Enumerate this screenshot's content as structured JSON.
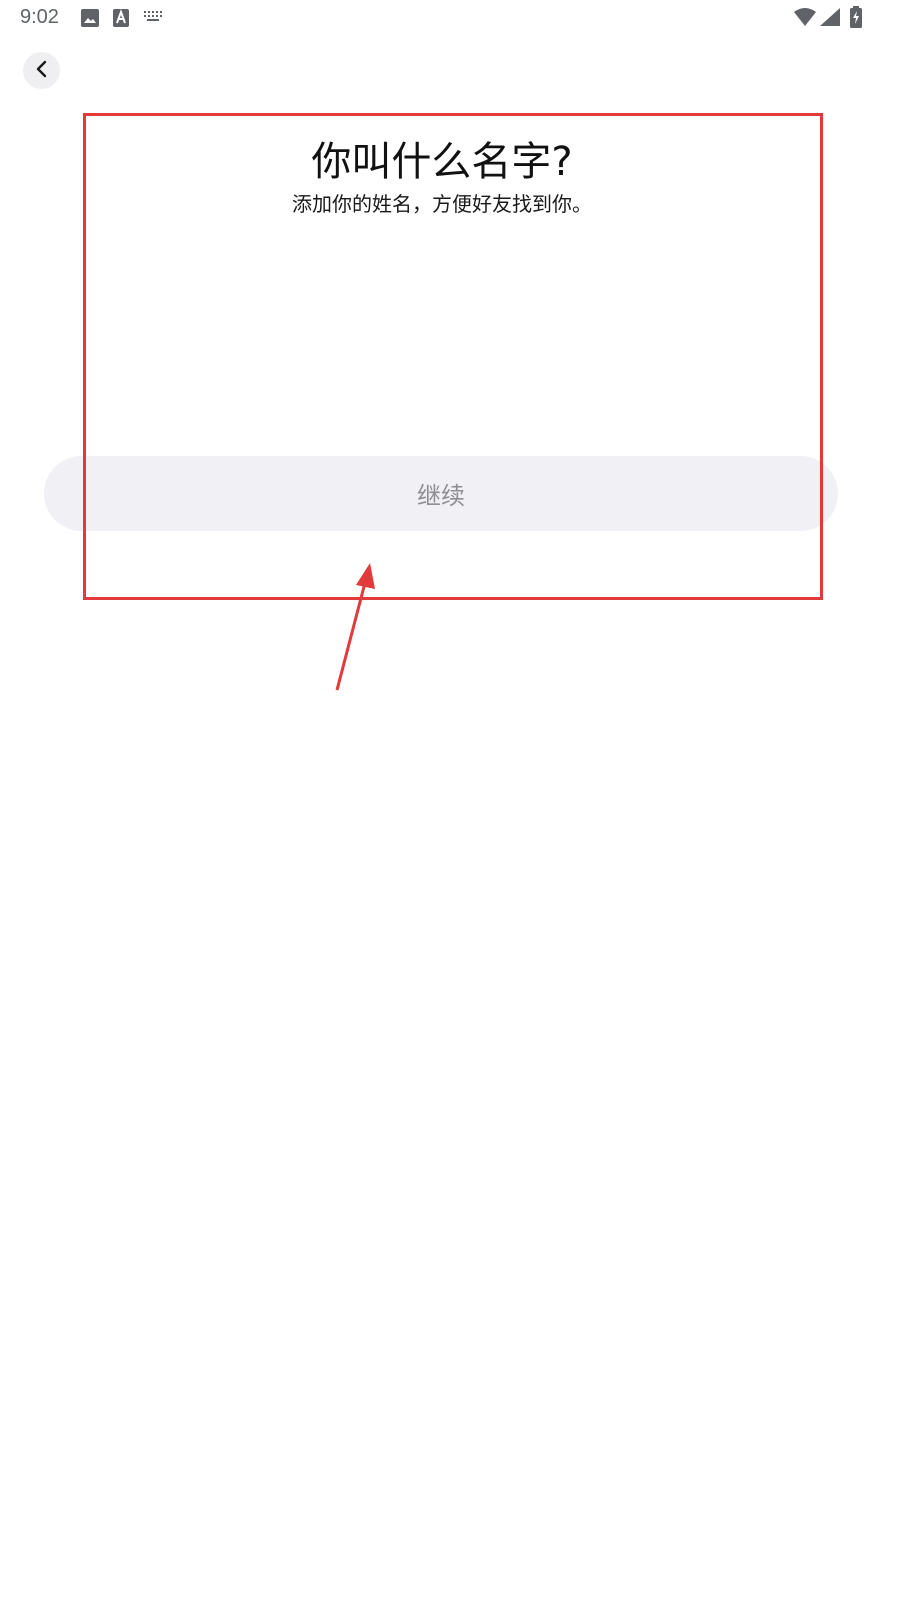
{
  "status_bar": {
    "time": "9:02",
    "left_icons": [
      "gallery-icon",
      "font-icon",
      "keyboard-icon"
    ],
    "right_icons": [
      "wifi-icon",
      "signal-icon",
      "battery-charging-icon"
    ]
  },
  "nav": {
    "back_icon": "chevron-left-icon"
  },
  "main": {
    "title": "你叫什么名字?",
    "subtitle": "添加你的姓名，方便好友找到你。",
    "continue_label": "继续"
  },
  "annotation": {
    "color": "#e23a3a"
  },
  "colors": {
    "background": "#ffffff",
    "button_bg": "#f0f0f5",
    "button_text": "#8e8e93",
    "back_button_bg": "#efeff1"
  }
}
